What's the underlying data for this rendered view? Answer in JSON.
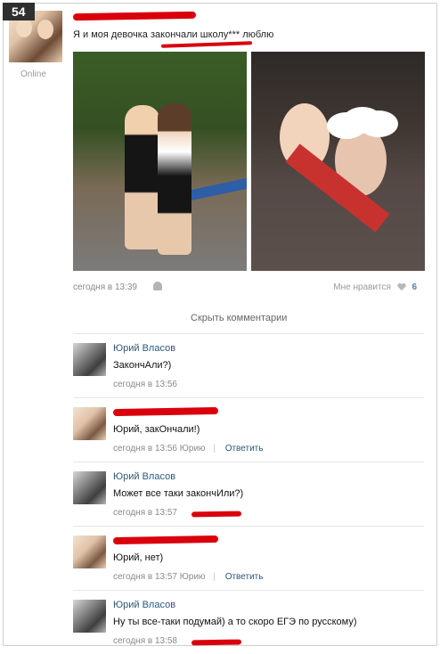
{
  "post": {
    "badge": "54",
    "status": "Online",
    "text": "Я и моя девочка закончали школу*** люблю",
    "time": "сегодня в 13:39",
    "likes_label": "Мне нравится",
    "likes_count": "6",
    "hide_comments": "Скрыть комментарии"
  },
  "comments": [
    {
      "name": "Юрий Власов",
      "text": "ЗакончАли?)",
      "time": "сегодня в 13:56",
      "reply_to": "",
      "reply_link": ""
    },
    {
      "name": "",
      "text": "Юрий, закОнчали!)",
      "time": "сегодня в 13:56 Юрию",
      "reply_to": "",
      "reply_link": "Ответить"
    },
    {
      "name": "Юрий Власов",
      "text": "Может все таки закончИли?)",
      "time": "сегодня в 13:57",
      "reply_to": "",
      "reply_link": ""
    },
    {
      "name": "",
      "text": "Юрий, нет)",
      "time": "сегодня в 13:57 Юрию",
      "reply_to": "",
      "reply_link": "Ответить"
    },
    {
      "name": "Юрий Власов",
      "text": "Ну ты все-таки подумай) а то скоро ЕГЭ по русскому)",
      "time": "сегодня в 13:58",
      "reply_to": "",
      "reply_link": ""
    }
  ],
  "icons": {
    "android": "android-icon",
    "heart": "heart-icon"
  }
}
